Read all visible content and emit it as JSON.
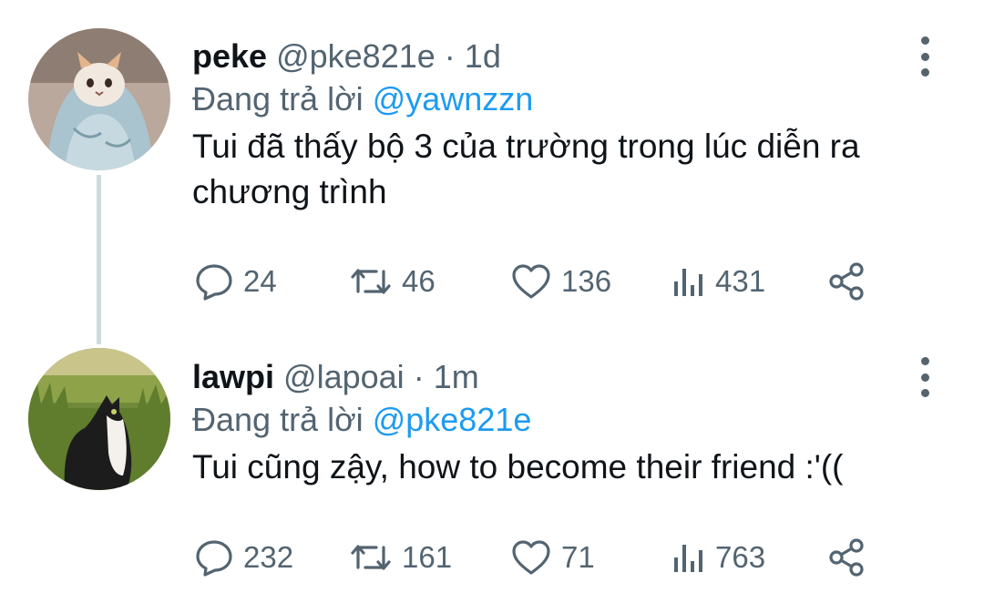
{
  "tweets": [
    {
      "name": "peke",
      "handle": "@pke821e",
      "separator": "·",
      "time": "1d",
      "reply_prefix": "Đang trả lời",
      "reply_to": "@yawnzzn",
      "text": "Tui đã thấy bộ 3 của trường trong lúc diễn ra chương trình",
      "replies": "24",
      "retweets": "46",
      "likes": "136",
      "views": "431",
      "avatar": "cat-in-blanket"
    },
    {
      "name": "lawpi",
      "handle": "@lapoai",
      "separator": "·",
      "time": "1m",
      "reply_prefix": "Đang trả lời",
      "reply_to": "@pke821e",
      "text": "Tui cũng zậy, how to become their friend :'((",
      "replies": "232",
      "retweets": "161",
      "likes": "71",
      "views": "763",
      "avatar": "cat-in-grass"
    }
  ],
  "icons": {
    "reply": "reply-icon",
    "retweet": "retweet-icon",
    "like": "heart-icon",
    "views": "views-icon",
    "share": "share-icon",
    "more": "more-options-icon"
  },
  "colors": {
    "accent": "#1d9bf0",
    "secondary_text": "#536471",
    "primary_text": "#0f1419",
    "thread_line": "#cfd9de"
  }
}
